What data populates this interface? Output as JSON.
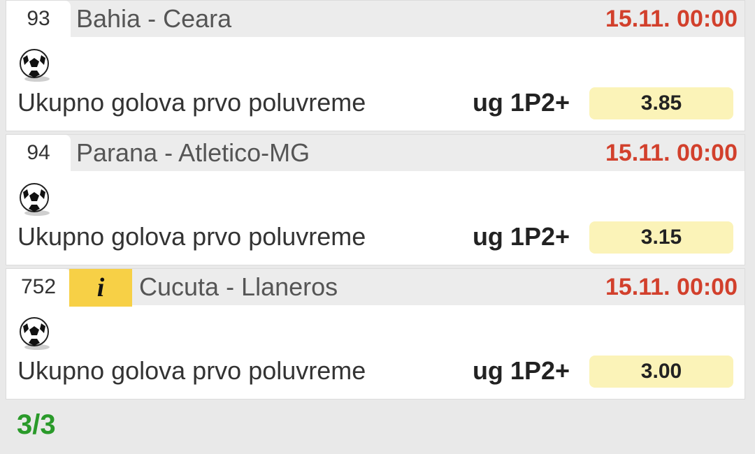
{
  "bets": [
    {
      "id": "93",
      "has_info": false,
      "match": "Bahia - Ceara",
      "datetime": "15.11. 00:00",
      "sport_icon": "soccer-ball-icon",
      "market": "Ukupno golova prvo poluvreme",
      "pick": "ug 1P2+",
      "odd": "3.85"
    },
    {
      "id": "94",
      "has_info": false,
      "match": "Parana - Atletico-MG",
      "datetime": "15.11. 00:00",
      "sport_icon": "soccer-ball-icon",
      "market": "Ukupno golova prvo poluvreme",
      "pick": "ug 1P2+",
      "odd": "3.15"
    },
    {
      "id": "752",
      "has_info": true,
      "info_label": "i",
      "match": "Cucuta - Llaneros",
      "datetime": "15.11. 00:00",
      "sport_icon": "soccer-ball-icon",
      "market": "Ukupno golova prvo poluvreme",
      "pick": "ug 1P2+",
      "odd": "3.00"
    }
  ],
  "footer": {
    "result": "3/3"
  },
  "colors": {
    "date": "#d2402c",
    "odd_bg": "#fbf3b8",
    "info_bg": "#f7d046",
    "result": "#2a9a2a"
  }
}
